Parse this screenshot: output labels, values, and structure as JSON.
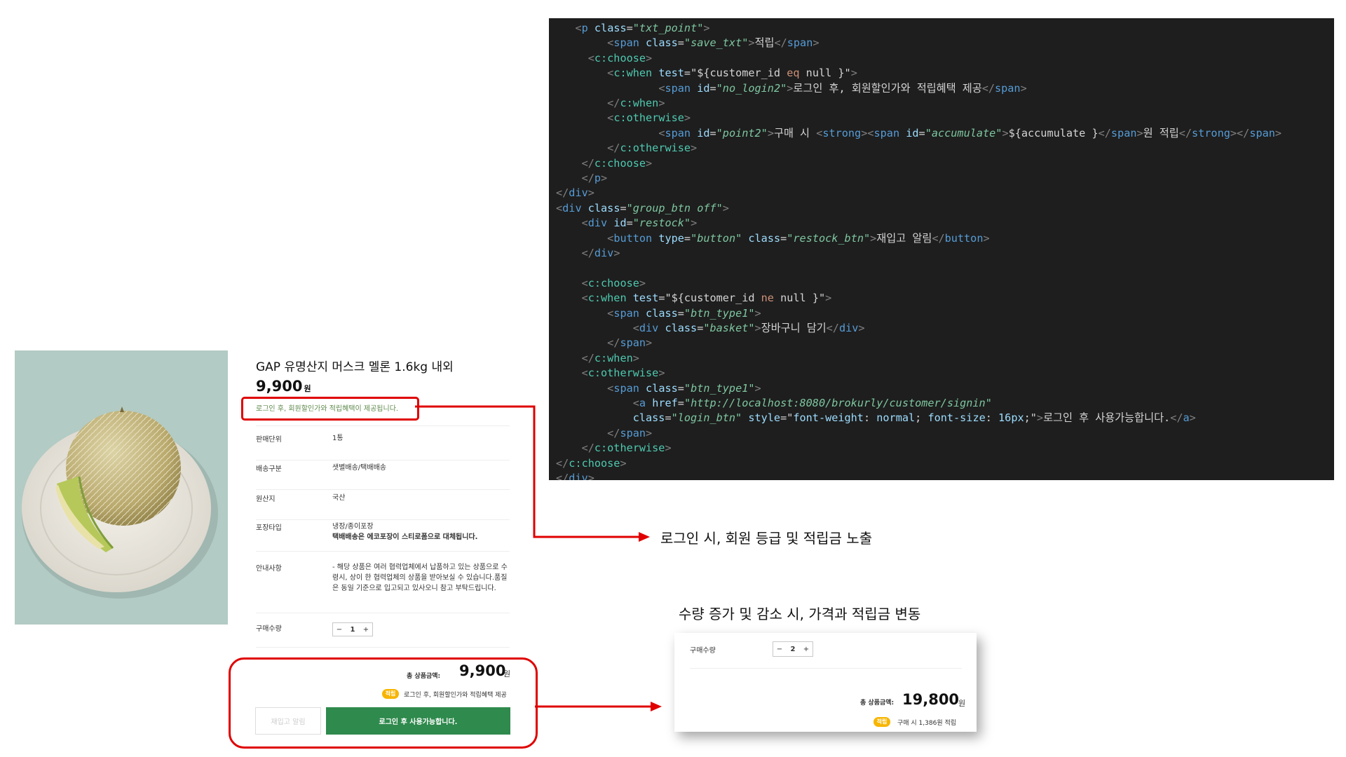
{
  "product": {
    "title": "GAP 유명산지 머스크 멜론 1.6kg 내외",
    "price": "9,900",
    "price_unit": "원",
    "login_notice": "로그인 후, 회원할인가와 적립혜택이 제공됩니다.",
    "info_rows": [
      {
        "label": "판매단위",
        "value": "1통",
        "value_bold": ""
      },
      {
        "label": "배송구분",
        "value": "샛별배송/택배배송",
        "value_bold": ""
      },
      {
        "label": "원산지",
        "value": "국산",
        "value_bold": ""
      },
      {
        "label": "포장타입",
        "value": "냉장/종이포장",
        "value_bold": "택배배송은 에코포장이 스티로폼으로 대체됩니다."
      },
      {
        "label": "안내사항",
        "value": "- 해당 상품은 여러 협력업체에서 납품하고 있는 상품으로 수령시, 상이 한 협력업체의 상품을 받아보실 수 있습니다.품질은 동일 기준으로 입고되고 있사오니 참고 부탁드립니다.",
        "value_bold": ""
      }
    ],
    "qty_label": "구매수량",
    "qty_minus": "−",
    "qty_value": "1",
    "qty_plus": "+",
    "total_label": "총 상품금액:",
    "total_value": "9,900",
    "total_unit": "원",
    "badge": "적립",
    "benefit_note": "로그인 후, 회원할인가와 적립혜택 제공",
    "restock_label": "재입고 알림",
    "login_button_label": "로그인 후 사용가능합니다."
  },
  "annotations": {
    "login_annotation": "로그인 시, 회원 등급 및 적립금 노출",
    "qty_annotation": "수량 증가 및 감소 시, 가격과 적립금 변동"
  },
  "qty_card": {
    "qty_label": "구매수량",
    "qty_minus": "−",
    "qty_value": "2",
    "qty_plus": "+",
    "total_label": "총 상품금액:",
    "total_value": "19,800",
    "total_unit": "원",
    "badge": "적립",
    "benefit_note": "구매 시 1,386원 적립"
  },
  "code": {
    "lines": [
      {
        "indent": "   ",
        "parts": [
          [
            "b",
            "<"
          ],
          [
            "e",
            "p"
          ],
          [
            "t",
            " "
          ],
          [
            "a",
            "class"
          ],
          [
            "t",
            "="
          ],
          [
            "s",
            "\"txt_point\""
          ],
          [
            "b",
            ">"
          ]
        ]
      },
      {
        "indent": "        ",
        "parts": [
          [
            "b",
            "<"
          ],
          [
            "e",
            "span"
          ],
          [
            "t",
            " "
          ],
          [
            "a",
            "class"
          ],
          [
            "t",
            "="
          ],
          [
            "s",
            "\"save_txt\""
          ],
          [
            "b",
            ">"
          ],
          [
            "t",
            "적립"
          ],
          [
            "b",
            "</"
          ],
          [
            "e",
            "span"
          ],
          [
            "b",
            ">"
          ]
        ]
      },
      {
        "indent": "     ",
        "parts": [
          [
            "b",
            "<"
          ],
          [
            "n",
            "c:choose"
          ],
          [
            "b",
            ">"
          ]
        ]
      },
      {
        "indent": "        ",
        "parts": [
          [
            "b",
            "<"
          ],
          [
            "n",
            "c:when"
          ],
          [
            "t",
            " "
          ],
          [
            "a",
            "test"
          ],
          [
            "t",
            "=\"${customer_id "
          ],
          [
            "o",
            "eq"
          ],
          [
            "t",
            " null }\""
          ],
          [
            "b",
            ">"
          ]
        ]
      },
      {
        "indent": "                ",
        "parts": [
          [
            "b",
            "<"
          ],
          [
            "e",
            "span"
          ],
          [
            "t",
            " "
          ],
          [
            "a",
            "id"
          ],
          [
            "t",
            "="
          ],
          [
            "s",
            "\"no_login2\""
          ],
          [
            "b",
            ">"
          ],
          [
            "t",
            "로그인 후, 회원할인가와 적립혜택 제공"
          ],
          [
            "b",
            "</"
          ],
          [
            "e",
            "span"
          ],
          [
            "b",
            ">"
          ]
        ]
      },
      {
        "indent": "        ",
        "parts": [
          [
            "b",
            "</"
          ],
          [
            "n",
            "c:when"
          ],
          [
            "b",
            ">"
          ]
        ]
      },
      {
        "indent": "        ",
        "parts": [
          [
            "b",
            "<"
          ],
          [
            "n",
            "c:otherwise"
          ],
          [
            "b",
            ">"
          ]
        ]
      },
      {
        "indent": "                ",
        "parts": [
          [
            "b",
            "<"
          ],
          [
            "e",
            "span"
          ],
          [
            "t",
            " "
          ],
          [
            "a",
            "id"
          ],
          [
            "t",
            "="
          ],
          [
            "s",
            "\"point2\""
          ],
          [
            "b",
            ">"
          ],
          [
            "t",
            "구매 시 "
          ],
          [
            "b",
            "<"
          ],
          [
            "e",
            "strong"
          ],
          [
            "b",
            "><"
          ],
          [
            "e",
            "span"
          ],
          [
            "t",
            " "
          ],
          [
            "a",
            "id"
          ],
          [
            "t",
            "="
          ],
          [
            "s",
            "\"accumulate\""
          ],
          [
            "b",
            ">"
          ],
          [
            "t",
            "${accumulate }"
          ],
          [
            "b",
            "</"
          ],
          [
            "e",
            "span"
          ],
          [
            "b",
            ">"
          ],
          [
            "t",
            "원 적립"
          ],
          [
            "b",
            "</"
          ],
          [
            "e",
            "strong"
          ],
          [
            "b",
            "></"
          ],
          [
            "e",
            "span"
          ],
          [
            "b",
            ">"
          ]
        ]
      },
      {
        "indent": "        ",
        "parts": [
          [
            "b",
            "</"
          ],
          [
            "n",
            "c:otherwise"
          ],
          [
            "b",
            ">"
          ]
        ]
      },
      {
        "indent": "    ",
        "parts": [
          [
            "b",
            "</"
          ],
          [
            "n",
            "c:choose"
          ],
          [
            "b",
            ">"
          ]
        ]
      },
      {
        "indent": "    ",
        "parts": [
          [
            "b",
            "</"
          ],
          [
            "e",
            "p"
          ],
          [
            "b",
            ">"
          ]
        ]
      },
      {
        "indent": "",
        "parts": [
          [
            "b",
            "</"
          ],
          [
            "e",
            "div"
          ],
          [
            "b",
            ">"
          ]
        ]
      },
      {
        "indent": "",
        "parts": [
          [
            "b",
            "<"
          ],
          [
            "e",
            "div"
          ],
          [
            "t",
            " "
          ],
          [
            "a",
            "class"
          ],
          [
            "t",
            "="
          ],
          [
            "s",
            "\"group_btn off\""
          ],
          [
            "b",
            ">"
          ]
        ]
      },
      {
        "indent": "    ",
        "parts": [
          [
            "b",
            "<"
          ],
          [
            "e",
            "div"
          ],
          [
            "t",
            " "
          ],
          [
            "a",
            "id"
          ],
          [
            "t",
            "="
          ],
          [
            "s",
            "\"restock\""
          ],
          [
            "b",
            ">"
          ]
        ]
      },
      {
        "indent": "        ",
        "parts": [
          [
            "b",
            "<"
          ],
          [
            "e",
            "button"
          ],
          [
            "t",
            " "
          ],
          [
            "a",
            "type"
          ],
          [
            "t",
            "="
          ],
          [
            "s",
            "\"button\""
          ],
          [
            "t",
            " "
          ],
          [
            "a",
            "class"
          ],
          [
            "t",
            "="
          ],
          [
            "s",
            "\"restock_btn\""
          ],
          [
            "b",
            ">"
          ],
          [
            "t",
            "재입고 알림"
          ],
          [
            "b",
            "</"
          ],
          [
            "e",
            "button"
          ],
          [
            "b",
            ">"
          ]
        ]
      },
      {
        "indent": "    ",
        "parts": [
          [
            "b",
            "</"
          ],
          [
            "e",
            "div"
          ],
          [
            "b",
            ">"
          ]
        ]
      },
      {
        "indent": "",
        "parts": []
      },
      {
        "indent": "    ",
        "parts": [
          [
            "b",
            "<"
          ],
          [
            "n",
            "c:choose"
          ],
          [
            "b",
            ">"
          ]
        ]
      },
      {
        "indent": "    ",
        "parts": [
          [
            "b",
            "<"
          ],
          [
            "n",
            "c:when"
          ],
          [
            "t",
            " "
          ],
          [
            "a",
            "test"
          ],
          [
            "t",
            "=\"${customer_id "
          ],
          [
            "o",
            "ne"
          ],
          [
            "t",
            " null }\""
          ],
          [
            "b",
            ">"
          ]
        ]
      },
      {
        "indent": "        ",
        "parts": [
          [
            "b",
            "<"
          ],
          [
            "e",
            "span"
          ],
          [
            "t",
            " "
          ],
          [
            "a",
            "class"
          ],
          [
            "t",
            "="
          ],
          [
            "s",
            "\"btn_type1\""
          ],
          [
            "b",
            ">"
          ]
        ]
      },
      {
        "indent": "            ",
        "parts": [
          [
            "b",
            "<"
          ],
          [
            "e",
            "div"
          ],
          [
            "t",
            " "
          ],
          [
            "a",
            "class"
          ],
          [
            "t",
            "="
          ],
          [
            "s",
            "\"basket\""
          ],
          [
            "b",
            ">"
          ],
          [
            "t",
            "장바구니 담기"
          ],
          [
            "b",
            "</"
          ],
          [
            "e",
            "div"
          ],
          [
            "b",
            ">"
          ]
        ]
      },
      {
        "indent": "        ",
        "parts": [
          [
            "b",
            "</"
          ],
          [
            "e",
            "span"
          ],
          [
            "b",
            ">"
          ]
        ]
      },
      {
        "indent": "    ",
        "parts": [
          [
            "b",
            "</"
          ],
          [
            "n",
            "c:when"
          ],
          [
            "b",
            ">"
          ]
        ]
      },
      {
        "indent": "    ",
        "parts": [
          [
            "b",
            "<"
          ],
          [
            "n",
            "c:otherwise"
          ],
          [
            "b",
            ">"
          ]
        ]
      },
      {
        "indent": "        ",
        "parts": [
          [
            "b",
            "<"
          ],
          [
            "e",
            "span"
          ],
          [
            "t",
            " "
          ],
          [
            "a",
            "class"
          ],
          [
            "t",
            "="
          ],
          [
            "s",
            "\"btn_type1\""
          ],
          [
            "b",
            ">"
          ]
        ]
      },
      {
        "indent": "            ",
        "parts": [
          [
            "b",
            "<"
          ],
          [
            "e",
            "a"
          ],
          [
            "t",
            " "
          ],
          [
            "a",
            "href"
          ],
          [
            "t",
            "="
          ],
          [
            "s",
            "\"http://localhost:8080/brokurly/customer/signin\""
          ]
        ]
      },
      {
        "indent": "            ",
        "parts": [
          [
            "a",
            "class"
          ],
          [
            "t",
            "="
          ],
          [
            "s",
            "\"login_btn\""
          ],
          [
            "t",
            " "
          ],
          [
            "a",
            "style"
          ],
          [
            "t",
            "=\""
          ],
          [
            "a",
            "font-weight"
          ],
          [
            "t",
            ": "
          ],
          [
            "a",
            "normal"
          ],
          [
            "t",
            "; "
          ],
          [
            "a",
            "font-size"
          ],
          [
            "t",
            ": "
          ],
          [
            "a",
            "16px"
          ],
          [
            "t",
            ";\""
          ],
          [
            "b",
            ">"
          ],
          [
            "t",
            "로그인 후 사용가능합니다."
          ],
          [
            "b",
            "</"
          ],
          [
            "e",
            "a"
          ],
          [
            "b",
            ">"
          ]
        ]
      },
      {
        "indent": "        ",
        "parts": [
          [
            "b",
            "</"
          ],
          [
            "e",
            "span"
          ],
          [
            "b",
            ">"
          ]
        ]
      },
      {
        "indent": "    ",
        "parts": [
          [
            "b",
            "</"
          ],
          [
            "n",
            "c:otherwise"
          ],
          [
            "b",
            ">"
          ]
        ]
      },
      {
        "indent": "",
        "parts": [
          [
            "b",
            "</"
          ],
          [
            "n",
            "c:choose"
          ],
          [
            "b",
            ">"
          ]
        ]
      },
      {
        "indent": "",
        "parts": [
          [
            "b",
            "</"
          ],
          [
            "e",
            "div"
          ],
          [
            "b",
            ">"
          ]
        ]
      }
    ]
  },
  "colors": {
    "brand_green": "#2f8a4d",
    "notice_green": "#5f8a4c",
    "highlight_red": "#e00000",
    "badge_yellow": "#f7b500",
    "editor_bg": "#1e1e1e"
  }
}
